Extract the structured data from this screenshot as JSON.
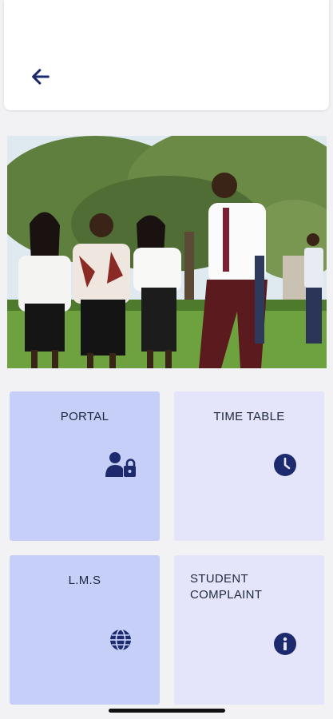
{
  "header": {
    "back_icon": "arrow-left-icon"
  },
  "hero": {
    "image": "students-on-campus-photo"
  },
  "tiles": [
    {
      "label": "PORTAL",
      "icon": "user-lock-icon",
      "color": "#c5cff8"
    },
    {
      "label": "TIME TABLE",
      "icon": "clock-icon",
      "color": "#e4e5fa"
    },
    {
      "label": "L.M.S",
      "icon": "globe-icon",
      "color": "#c5cff8"
    },
    {
      "label": "STUDENT COMPLAINT",
      "icon": "info-icon",
      "color": "#e4e5fa"
    }
  ],
  "colors": {
    "icon": "#1e2a6e",
    "background": "#f2f2f4"
  }
}
